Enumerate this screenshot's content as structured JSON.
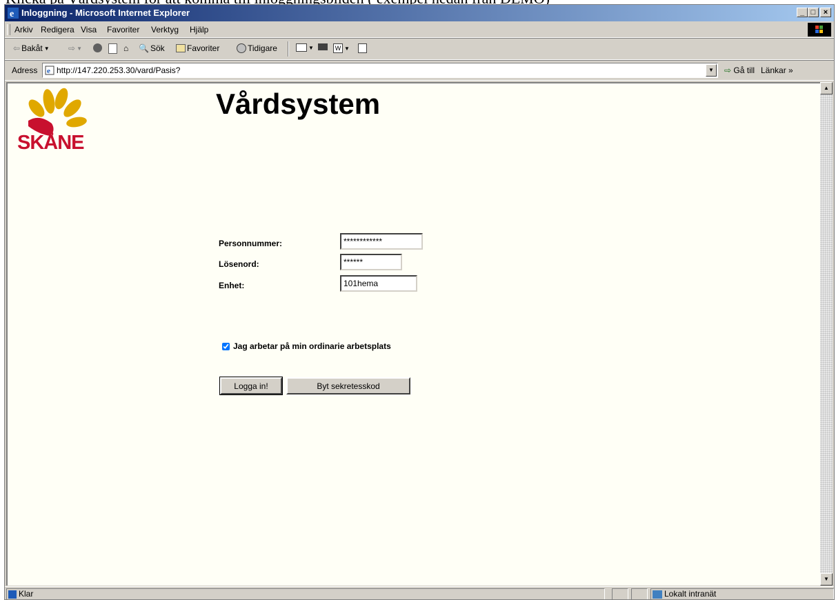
{
  "doc_caption": "Klicka på Vårdsystem för att komma till inloggningsbilden ( exempel nedan från DEMO)",
  "window": {
    "title": "Inloggning - Microsoft Internet Explorer",
    "controls": {
      "minimize": "_",
      "maximize": "□",
      "close": "×"
    }
  },
  "menubar": {
    "items": [
      "Arkiv",
      "Redigera",
      "Visa",
      "Favoriter",
      "Verktyg",
      "Hjälp"
    ]
  },
  "toolbar": {
    "back": "Bakåt",
    "search": "Sök",
    "favorites": "Favoriter",
    "history": "Tidigare"
  },
  "addressbar": {
    "label": "Adress",
    "url": "http://147.220.253.30/vard/Pasis?",
    "go": "Gå till",
    "links": "Länkar »"
  },
  "page": {
    "logo_text": "SKÅNE",
    "title": "Vårdsystem",
    "form": {
      "personnummer_label": "Personnummer:",
      "personnummer_value": "************",
      "losenord_label": "Lösenord:",
      "losenord_value": "******",
      "enhet_label": "Enhet:",
      "enhet_value": "101hema",
      "checkbox_label": "Jag arbetar på min ordinarie arbetsplats",
      "checkbox_checked": true,
      "login_button": "Logga in!",
      "change_code_button": "Byt sekretesskod"
    }
  },
  "statusbar": {
    "status": "Klar",
    "zone": "Lokalt intranät"
  },
  "colors": {
    "title_gradient_start": "#0a246a",
    "page_background": "#fffff6",
    "logo_red": "#c8102e",
    "logo_gold": "#e0a800"
  }
}
